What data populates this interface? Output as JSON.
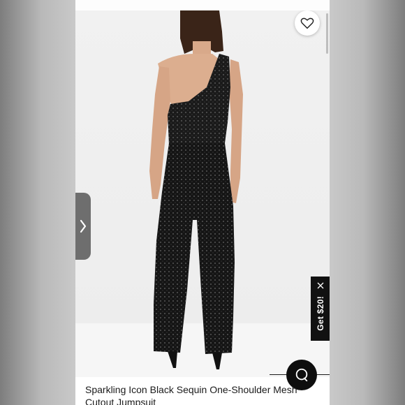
{
  "product": {
    "title": "Sparkling Icon Black Sequin One-Shoulder Mesh Cutout Jumpsuit"
  },
  "promo": {
    "label": "Get $20!"
  },
  "icons": {
    "wishlist": "heart-icon",
    "previous": "chevron-right-icon",
    "promo_close": "close-icon",
    "chat": "chat-bubble-icon"
  },
  "colors": {
    "promo_background": "#111111",
    "chat_background": "#0e0e0e",
    "nav_tab": "#6e6e6e"
  }
}
